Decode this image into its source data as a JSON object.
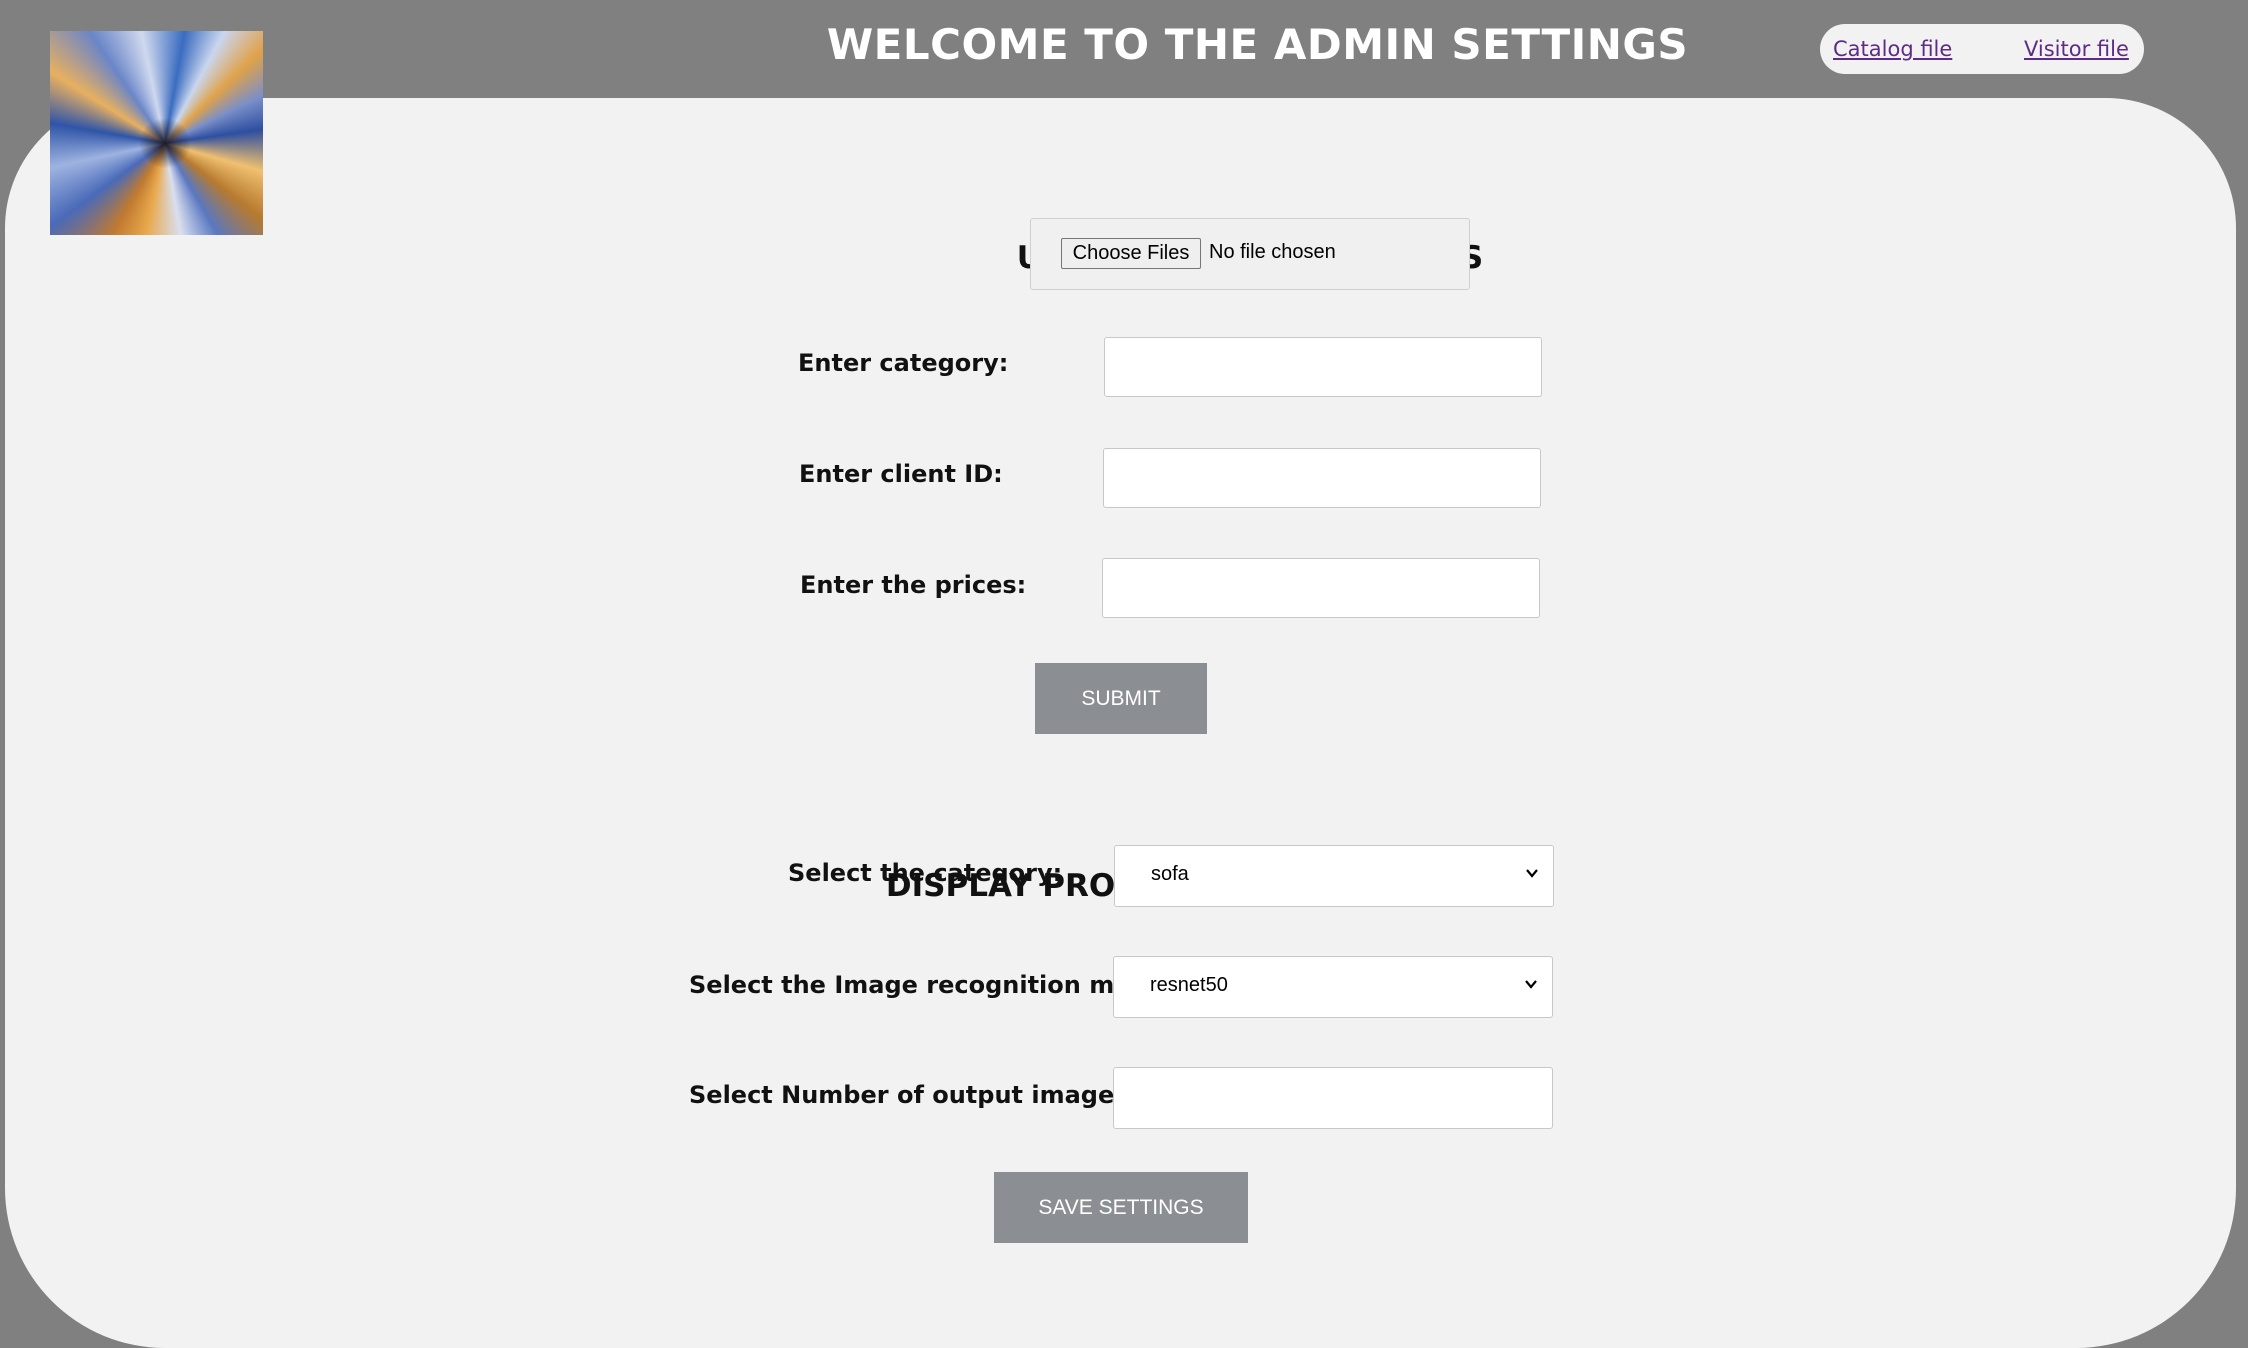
{
  "header": {
    "title": "WELCOME TO THE ADMIN SETTINGS",
    "nav": {
      "catalog_link": "Catalog file",
      "visitor_link": "Visitor file"
    }
  },
  "upload": {
    "heading": "UPLOAD PRODUCT IMAGES",
    "choose_files_label": "Choose Files",
    "file_status": "No file chosen",
    "category_label": "Enter category:",
    "category_value": "",
    "client_id_label": "Enter client ID:",
    "client_id_value": "",
    "prices_label": "Enter the prices:",
    "prices_value": "",
    "submit_label": "SUBMIT"
  },
  "display": {
    "heading": "DISPLAY PRODUCT IMAGES",
    "category_label": "Select the category:",
    "category_selected": "sofa",
    "model_label": "Select the Image recognition model:",
    "model_selected": "resnet50",
    "output_count_label": "Select Number of output images:",
    "output_count_value": "",
    "save_label": "SAVE SETTINGS"
  },
  "icons": {
    "logo": "abstract-zoom-blur-logo",
    "dropdown": "chevron-down-icon"
  },
  "colors": {
    "page_background": "#808080",
    "panel_background": "#f2f2f2",
    "button_background": "#8b8f93",
    "link_color": "#5e2c86"
  }
}
